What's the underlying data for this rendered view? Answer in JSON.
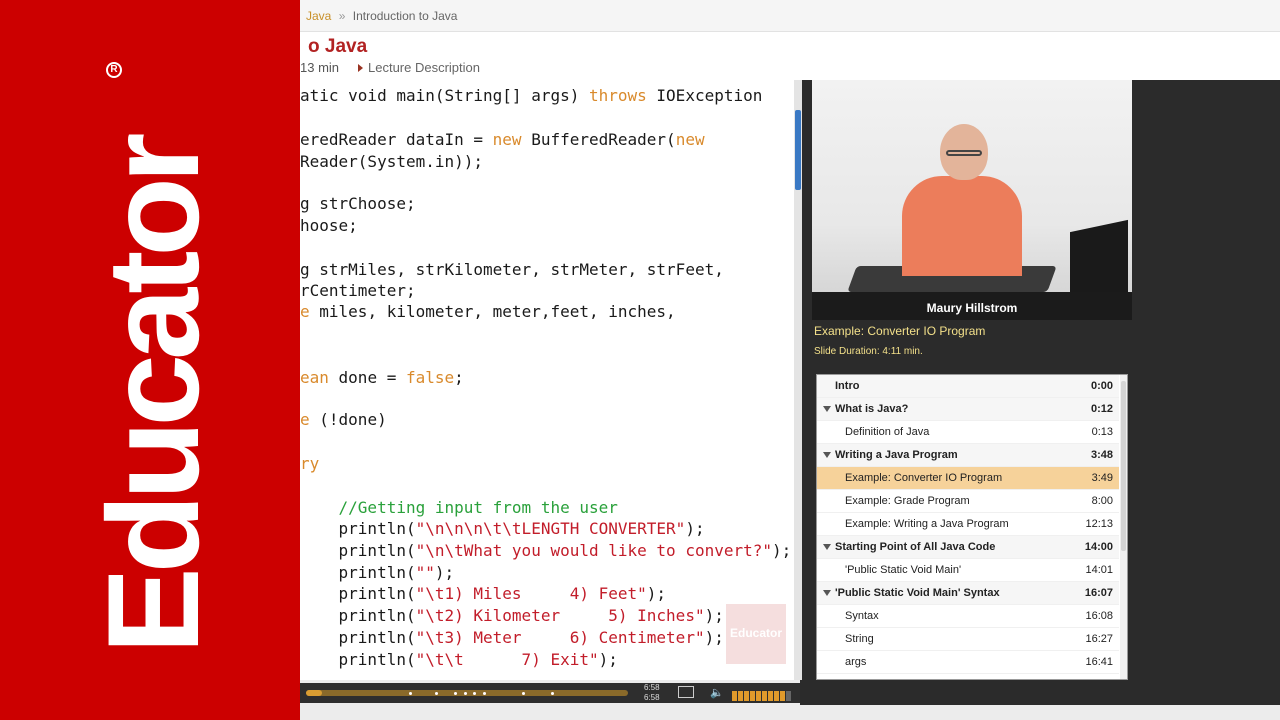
{
  "brand": {
    "wordmark": "Educator",
    "registered_mark": "R"
  },
  "breadcrumb": {
    "link": "Java",
    "separator": "»",
    "current": "Introduction to Java"
  },
  "lecture": {
    "title_visible": "o Java",
    "duration": "13 min",
    "description_link": "Lecture Description"
  },
  "code_slide": {
    "lines": [
      {
        "parts": [
          {
            "t": "atic void main(String[] args) ",
            "c": ""
          },
          {
            "t": "throws",
            "c": "kw"
          },
          {
            "t": " IOException",
            "c": ""
          }
        ]
      },
      {
        "parts": [
          {
            "t": "eredReader dataIn = ",
            "c": ""
          },
          {
            "t": "new",
            "c": "kw"
          },
          {
            "t": " BufferedReader(",
            "c": ""
          },
          {
            "t": "new",
            "c": "kw"
          }
        ]
      },
      {
        "parts": [
          {
            "t": "Reader(System.in));",
            "c": ""
          }
        ]
      },
      {
        "parts": [
          {
            "t": "g strChoose;",
            "c": ""
          }
        ]
      },
      {
        "parts": [
          {
            "t": "hoose;",
            "c": ""
          }
        ]
      },
      {
        "parts": [
          {
            "t": "g strMiles, strKilometer, strMeter, strFeet,",
            "c": ""
          }
        ]
      },
      {
        "parts": [
          {
            "t": "rCentimeter;",
            "c": ""
          }
        ]
      },
      {
        "parts": [
          {
            "t": "e",
            "c": "kw"
          },
          {
            "t": " miles, kilometer, meter,feet, inches,",
            "c": ""
          }
        ]
      },
      {
        "parts": [
          {
            "t": "ean",
            "c": "kw"
          },
          {
            "t": " done = ",
            "c": ""
          },
          {
            "t": "false",
            "c": "kw"
          },
          {
            "t": ";",
            "c": ""
          }
        ]
      },
      {
        "parts": [
          {
            "t": "e",
            "c": "kw"
          },
          {
            "t": " (!done)",
            "c": ""
          }
        ]
      },
      {
        "parts": [
          {
            "t": "ry",
            "c": "kw"
          }
        ]
      },
      {
        "parts": [
          {
            "t": "    //Getting input from the user",
            "c": "cmt"
          }
        ]
      },
      {
        "parts": [
          {
            "t": "    println(",
            "c": ""
          },
          {
            "t": "\"\\n\\n\\n\\t\\tLENGTH CONVERTER\"",
            "c": "str"
          },
          {
            "t": ");",
            "c": ""
          }
        ]
      },
      {
        "parts": [
          {
            "t": "    println(",
            "c": ""
          },
          {
            "t": "\"\\n\\tWhat you would like to convert?\"",
            "c": "str"
          },
          {
            "t": ");",
            "c": ""
          }
        ]
      },
      {
        "parts": [
          {
            "t": "    println(",
            "c": ""
          },
          {
            "t": "\"\"",
            "c": "str"
          },
          {
            "t": ");",
            "c": ""
          }
        ]
      },
      {
        "parts": [
          {
            "t": "    println(",
            "c": ""
          },
          {
            "t": "\"\\t1) Miles     4) Feet\"",
            "c": "str"
          },
          {
            "t": ");",
            "c": ""
          }
        ]
      },
      {
        "parts": [
          {
            "t": "    println(",
            "c": ""
          },
          {
            "t": "\"\\t2) Kilometer     5) Inches\"",
            "c": "str"
          },
          {
            "t": ");",
            "c": ""
          }
        ]
      },
      {
        "parts": [
          {
            "t": "    println(",
            "c": ""
          },
          {
            "t": "\"\\t3) Meter     6) Centimeter\"",
            "c": "str"
          },
          {
            "t": ");",
            "c": ""
          }
        ]
      },
      {
        "parts": [
          {
            "t": "    println(",
            "c": ""
          },
          {
            "t": "\"\\t\\t      7) Exit\"",
            "c": "str"
          },
          {
            "t": ");",
            "c": ""
          }
        ]
      }
    ],
    "watermark": "Educator"
  },
  "video": {
    "presenter_name": "Maury Hillstrom"
  },
  "current_slide": {
    "title": "Example: Converter IO Program",
    "duration": "Slide Duration: 4:11 min."
  },
  "chapters": [
    {
      "label": "Intro",
      "time": "0:00",
      "kind": "section",
      "arrow": false
    },
    {
      "label": "What is Java?",
      "time": "0:12",
      "kind": "section",
      "arrow": true
    },
    {
      "label": "Definition of Java",
      "time": "0:13",
      "kind": "item",
      "arrow": false
    },
    {
      "label": "Writing a Java Program",
      "time": "3:48",
      "kind": "section",
      "arrow": true
    },
    {
      "label": "Example: Converter IO Program",
      "time": "3:49",
      "kind": "active",
      "arrow": false
    },
    {
      "label": "Example: Grade Program",
      "time": "8:00",
      "kind": "item",
      "arrow": false
    },
    {
      "label": "Example: Writing a Java Program",
      "time": "12:13",
      "kind": "item",
      "arrow": false
    },
    {
      "label": "Starting Point of All Java Code",
      "time": "14:00",
      "kind": "section",
      "arrow": true
    },
    {
      "label": "'Public Static Void Main'",
      "time": "14:01",
      "kind": "item",
      "arrow": false
    },
    {
      "label": "'Public Static Void Main' Syntax",
      "time": "16:07",
      "kind": "section",
      "arrow": true
    },
    {
      "label": "Syntax",
      "time": "16:08",
      "kind": "item",
      "arrow": false
    },
    {
      "label": "String",
      "time": "16:27",
      "kind": "item",
      "arrow": false
    },
    {
      "label": "args",
      "time": "16:41",
      "kind": "item",
      "arrow": false
    }
  ],
  "controls": {
    "time_elapsed": "6:58",
    "time_total": "6:58",
    "progress_fraction": 0.05,
    "volume_fraction": 0.9,
    "screen_icon": "fullscreen-icon",
    "volume_icon": "speaker-icon"
  },
  "colors": {
    "brand_red": "#cc0000",
    "accent_orange": "#d99d32",
    "keyword": "#d98a2c",
    "string": "#c21d2a",
    "comment": "#2aa13b"
  }
}
